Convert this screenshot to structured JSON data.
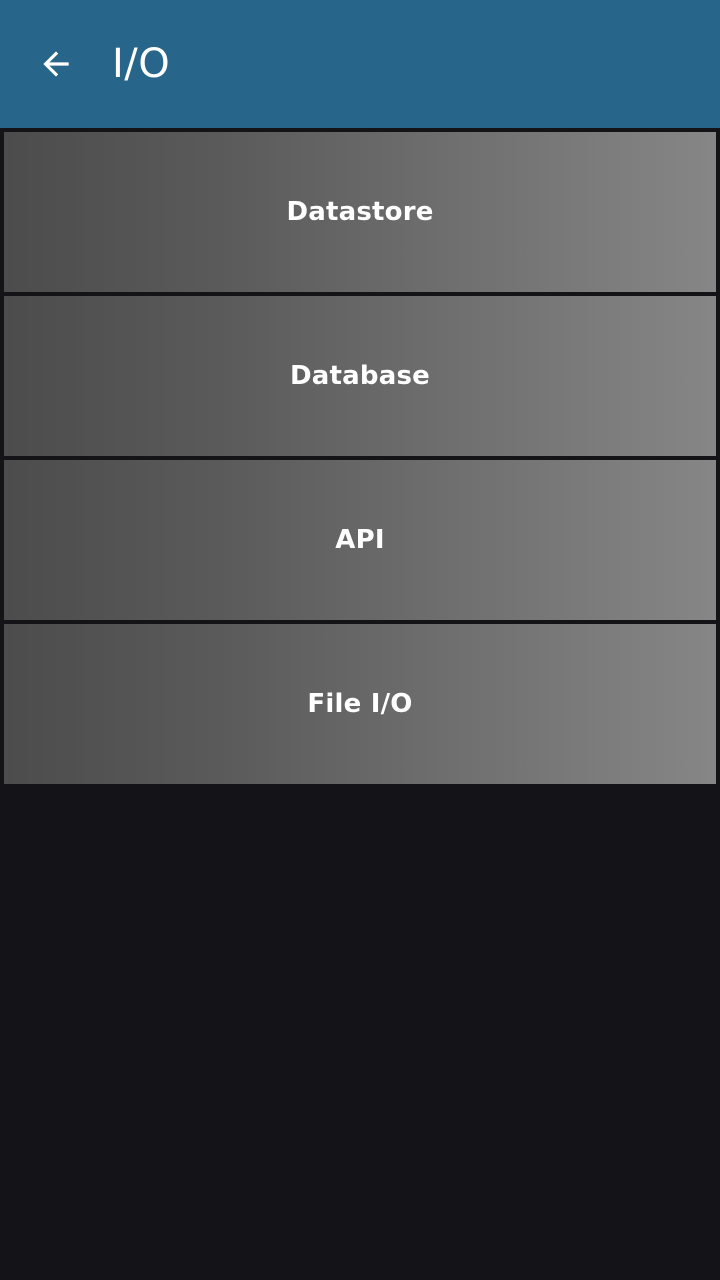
{
  "app_bar": {
    "title": "I/O",
    "back_icon": "arrow-back-icon",
    "background_color": "#27658a"
  },
  "menu": {
    "items": [
      {
        "label": "Datastore"
      },
      {
        "label": "Database"
      },
      {
        "label": "API"
      },
      {
        "label": "File I/O"
      }
    ]
  },
  "colors": {
    "page_background": "#141318",
    "item_gradient_start": "#4c4c4c",
    "item_gradient_end": "#868686",
    "text": "#ffffff"
  }
}
